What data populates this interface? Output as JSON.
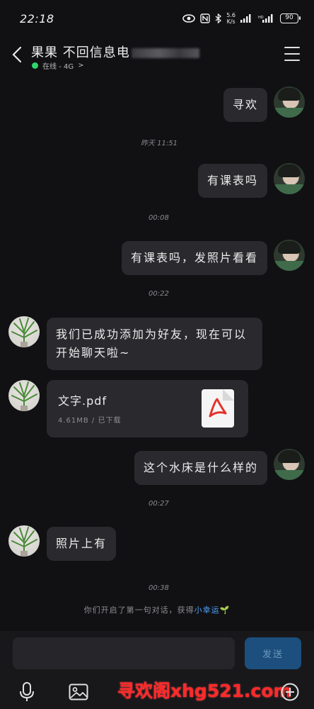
{
  "status": {
    "time": "22:18",
    "net_speed_value": "5.6",
    "net_speed_unit": "K/s",
    "battery": "90"
  },
  "header": {
    "title": "果果 不回信息电",
    "presence": "在线 - 4G",
    "presence_chevron": ">"
  },
  "messages": [
    {
      "side": "right",
      "text": "寻欢"
    },
    {
      "type": "time",
      "text": "昨天 11:51"
    },
    {
      "side": "right",
      "text": "有课表吗"
    },
    {
      "type": "time",
      "text": "00:08"
    },
    {
      "side": "right",
      "text": "有课表吗，发照片看看"
    },
    {
      "type": "time",
      "text": "00:22"
    },
    {
      "side": "left",
      "text": "我们已成功添加为好友，现在可以开始聊天啦~"
    },
    {
      "side": "left",
      "type": "file",
      "file_name": "文字.pdf",
      "file_meta": "4.61MB / 已下载"
    },
    {
      "side": "right",
      "text": "这个水床是什么样的"
    },
    {
      "type": "time",
      "text": "00:27"
    },
    {
      "side": "left",
      "text": "照片上有"
    },
    {
      "type": "time",
      "text": "00:38"
    }
  ],
  "system_note": {
    "prefix": "你们开启了第一句对话，获得",
    "link": "小幸运",
    "emoji": "🌱"
  },
  "input": {
    "value": "",
    "send_label": "发送"
  },
  "toolbar": {
    "items": [
      "mic-icon",
      "image-icon",
      "add-icon"
    ]
  },
  "watermark": "寻欢阁xhg521.com",
  "colors": {
    "background": "#111114",
    "bubble": "#2a2a2e",
    "online": "#2fd66b",
    "send_button": "#1c4f7d",
    "link": "#4ea3ff",
    "watermark": "#ff2a2a"
  }
}
